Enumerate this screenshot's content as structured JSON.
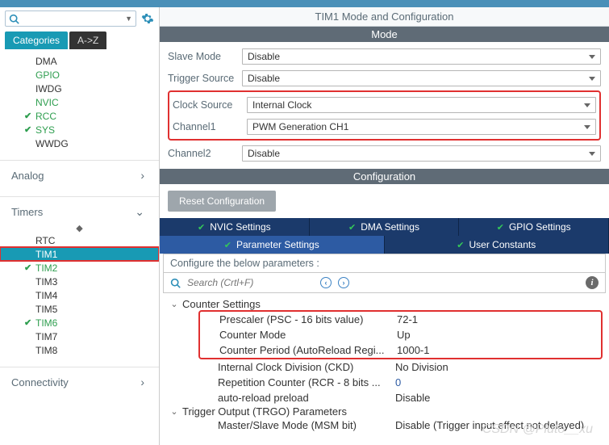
{
  "search": {
    "placeholder": ""
  },
  "gear_icon": "gear",
  "left_tabs": [
    "Categories",
    "A->Z"
  ],
  "tree_top": [
    {
      "label": "DMA",
      "green": false,
      "chk": false
    },
    {
      "label": "GPIO",
      "green": true,
      "chk": false
    },
    {
      "label": "IWDG",
      "green": false,
      "chk": false
    },
    {
      "label": "NVIC",
      "green": true,
      "chk": false
    },
    {
      "label": "RCC",
      "green": true,
      "chk": true
    },
    {
      "label": "SYS",
      "green": true,
      "chk": true
    },
    {
      "label": "WWDG",
      "green": false,
      "chk": false
    }
  ],
  "section_analog": "Analog",
  "section_timers": "Timers",
  "section_conn": "Connectivity",
  "timers_list": [
    {
      "label": "RTC",
      "green": false,
      "chk": false,
      "sel": false,
      "boxed": false
    },
    {
      "label": "TIM1",
      "green": false,
      "chk": false,
      "sel": true,
      "boxed": true
    },
    {
      "label": "TIM2",
      "green": true,
      "chk": true,
      "sel": false,
      "boxed": false
    },
    {
      "label": "TIM3",
      "green": false,
      "chk": false,
      "sel": false,
      "boxed": false
    },
    {
      "label": "TIM4",
      "green": false,
      "chk": false,
      "sel": false,
      "boxed": false
    },
    {
      "label": "TIM5",
      "green": false,
      "chk": false,
      "sel": false,
      "boxed": false
    },
    {
      "label": "TIM6",
      "green": true,
      "chk": true,
      "sel": false,
      "boxed": false
    },
    {
      "label": "TIM7",
      "green": false,
      "chk": false,
      "sel": false,
      "boxed": false
    },
    {
      "label": "TIM8",
      "green": false,
      "chk": false,
      "sel": false,
      "boxed": false
    }
  ],
  "title": "TIM1 Mode and Configuration",
  "band_mode": "Mode",
  "band_config": "Configuration",
  "mode_rows": {
    "slave_label": "Slave Mode",
    "slave_value": "Disable",
    "trigger_label": "Trigger Source",
    "trigger_value": "Disable",
    "clock_label": "Clock Source",
    "clock_value": "Internal Clock",
    "ch1_label": "Channel1",
    "ch1_value": "PWM Generation CH1",
    "ch2_label": "Channel2",
    "ch2_value": "Disable"
  },
  "reset_btn": "Reset Configuration",
  "subtabs_row1": [
    "NVIC Settings",
    "DMA Settings",
    "GPIO Settings"
  ],
  "subtabs_row2": [
    "Parameter Settings",
    "User Constants"
  ],
  "cfg_hint": "Configure the below parameters :",
  "cfg_search_placeholder": "Search (Crtl+F)",
  "params": {
    "group1": "Counter Settings",
    "rows1_boxed": [
      {
        "l": "Prescaler (PSC - 16 bits value)",
        "v": "72-1"
      },
      {
        "l": "Counter Mode",
        "v": "Up"
      },
      {
        "l": "Counter Period (AutoReload Regi...",
        "v": "1000-1"
      }
    ],
    "rows1_rest": [
      {
        "l": "Internal Clock Division (CKD)",
        "v": "No Division"
      },
      {
        "l": "Repetition Counter (RCR - 8 bits ...",
        "v": "0",
        "blue": true
      },
      {
        "l": "auto-reload preload",
        "v": "Disable"
      }
    ],
    "group2": "Trigger Output (TRGO) Parameters",
    "rows2": [
      {
        "l": "Master/Slave Mode (MSM bit)",
        "v": "Disable (Trigger input effect not delayed)"
      }
    ]
  },
  "watermark": "CSDN @Pluto__xu"
}
